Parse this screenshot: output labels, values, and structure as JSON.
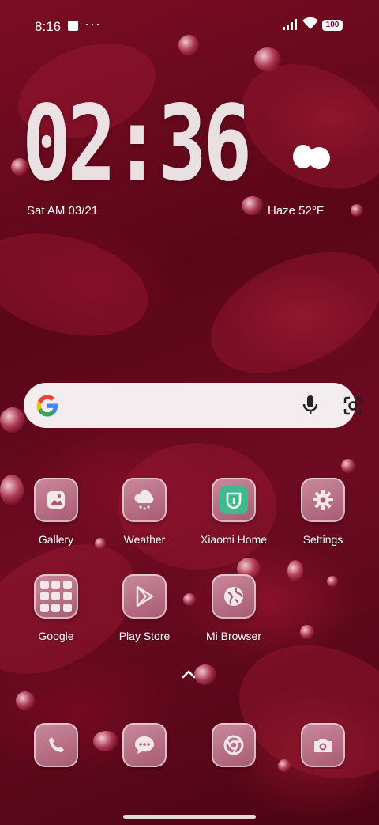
{
  "status_bar": {
    "time": "8:16",
    "dots": "···",
    "battery": "100"
  },
  "clock": {
    "time": "02:36",
    "date": "Sat AM 03/21"
  },
  "weather": {
    "text": "Haze  52°F",
    "icon": "cloudy-icon"
  },
  "search": {
    "icons": [
      "google-logo-icon",
      "mic-icon",
      "lens-icon"
    ]
  },
  "apps": [
    {
      "label": "Gallery",
      "icon": "gallery-icon"
    },
    {
      "label": "Weather",
      "icon": "weather-icon"
    },
    {
      "label": "Xiaomi Home",
      "icon": "xiaomi-home-icon"
    },
    {
      "label": "Settings",
      "icon": "gear-icon"
    },
    {
      "label": "Google",
      "icon": "google-folder-icon"
    },
    {
      "label": "Play Store",
      "icon": "play-store-icon"
    },
    {
      "label": "Mi Browser",
      "icon": "globe-icon"
    }
  ],
  "dock": [
    {
      "icon": "phone-icon"
    },
    {
      "icon": "messages-icon"
    },
    {
      "icon": "chrome-icon"
    },
    {
      "icon": "camera-icon"
    }
  ],
  "colors": {
    "tile": "#b06a80",
    "wallpaper": "#6e0b22",
    "xiaomi_home": "#3dbb8c"
  }
}
